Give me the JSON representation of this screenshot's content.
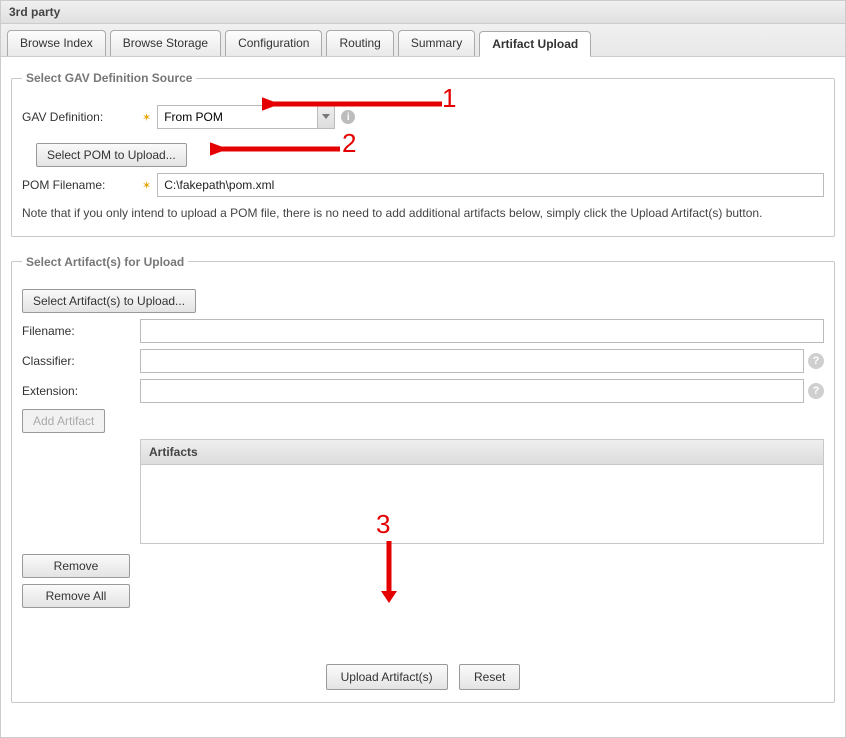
{
  "panel_title": "3rd party",
  "tabs": [
    {
      "label": "Browse Index",
      "active": false
    },
    {
      "label": "Browse Storage",
      "active": false
    },
    {
      "label": "Configuration",
      "active": false
    },
    {
      "label": "Routing",
      "active": false
    },
    {
      "label": "Summary",
      "active": false
    },
    {
      "label": "Artifact Upload",
      "active": true
    }
  ],
  "gav_section": {
    "legend": "Select GAV Definition Source",
    "definition_label": "GAV Definition:",
    "definition_value": "From POM",
    "select_pom_button": "Select POM to Upload...",
    "pom_filename_label": "POM Filename:",
    "pom_filename_value": "C:\\fakepath\\pom.xml",
    "note": "Note that if you only intend to upload a POM file, there is no need to add additional artifacts below, simply click the Upload Artifact(s) button."
  },
  "artifact_section": {
    "legend": "Select Artifact(s) for Upload",
    "select_artifacts_button": "Select Artifact(s) to Upload...",
    "filename_label": "Filename:",
    "filename_value": "",
    "classifier_label": "Classifier:",
    "classifier_value": "",
    "extension_label": "Extension:",
    "extension_value": "",
    "add_artifact_button": "Add Artifact",
    "artifacts_header": "Artifacts",
    "remove_button": "Remove",
    "remove_all_button": "Remove All",
    "upload_button": "Upload Artifact(s)",
    "reset_button": "Reset"
  },
  "annotations": {
    "n1": "1",
    "n2": "2",
    "n3": "3"
  }
}
